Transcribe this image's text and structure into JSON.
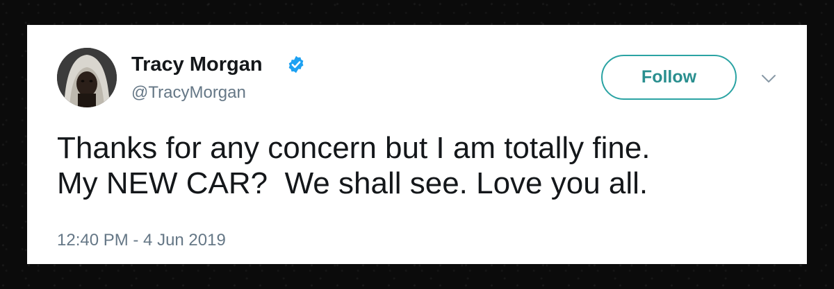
{
  "tweet": {
    "author": {
      "name": "Tracy Morgan",
      "handle": "@TracyMorgan",
      "verified": true,
      "avatar_icon": "person-avatar"
    },
    "follow_label": "Follow",
    "menu_icon": "chevron-down-icon",
    "text_lines": [
      "Thanks for any concern but I am totally fine.",
      "My NEW CAR?  We shall see. Love you all."
    ],
    "timestamp": "12:40 PM - 4 Jun 2019"
  },
  "colors": {
    "background": "#0b0b0b",
    "card": "#ffffff",
    "name": "#14171a",
    "secondary_text": "#657786",
    "verified_badge": "#1da1f2",
    "follow_accent": "#2aa3a3"
  }
}
